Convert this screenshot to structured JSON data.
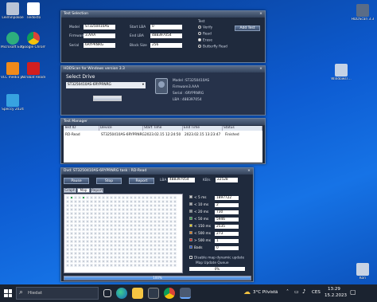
{
  "desktop": {
    "icons_left": [
      {
        "label": "Leiminpokoe",
        "icon": "recycle-bin-full-icon"
      },
      {
        "label": "Tiedosto",
        "icon": "file-icon"
      },
      {
        "label": "Microsoft Edge",
        "icon": "edge-icon"
      },
      {
        "label": "Google Chrome",
        "icon": "chrome-icon"
      },
      {
        "label": "VLC media player",
        "icon": "vlc-icon"
      },
      {
        "label": "Acrobat Reader DC",
        "icon": "acrobat-icon"
      },
      {
        "label": "Speccy 2024",
        "icon": "speccy-icon"
      }
    ],
    "icons_right": [
      {
        "label": "HDDScan 3.3",
        "icon": "hddscan-icon"
      },
      {
        "label": "WindowsT...",
        "icon": "folder-icon"
      },
      {
        "label": "Kori",
        "icon": "recycle-bin-icon"
      }
    ]
  },
  "test_selection": {
    "title": "Test Selection",
    "model_label": "Model",
    "model_value": "ST3250410AS",
    "firmware_label": "Firmware",
    "firmware_value": "3.AAA",
    "serial_label": "Serial",
    "serial_value": "6RYPRNRG",
    "start_lba_label": "Start LBA",
    "start_lba_value": "0",
    "end_lba_label": "End LBA",
    "end_lba_value": "488397054",
    "block_size_label": "Block Size",
    "block_size_value": "256",
    "test_label": "Test",
    "radios": [
      {
        "label": "Verify",
        "on": false
      },
      {
        "label": "Read",
        "on": false
      },
      {
        "label": "Erase",
        "on": true
      },
      {
        "label": "Butterfly Read",
        "on": false
      }
    ],
    "add_test": "Add Test"
  },
  "hddscan": {
    "title": "HDDScan for Windows version 3.3",
    "select_drive": "Select Drive",
    "drive_value": "ST3250410AS-6RYPRNRG",
    "model_label": "Model :",
    "model_value": "ST3250410AS",
    "firmware_label": "Firmware :",
    "firmware_value": "3.AAA",
    "serial_label": "Serial :",
    "serial_value": "6RYPRNRG",
    "lba_label": "LBA :",
    "lba_value": "488397054"
  },
  "test_manager": {
    "title": "Test Manager",
    "columns": [
      "Test ID",
      "Device",
      "Start Time",
      "End Time",
      "Status"
    ],
    "rows": [
      [
        "RD-Read",
        "ST3250410AS-6RYPRNRG",
        "2023.02.15 12:24:50",
        "2023.02.15 13:23:47",
        "Finished"
      ]
    ]
  },
  "test_window": {
    "title": "Dvd: ST3250410AS-6RYPRNRG  task : RD-Read",
    "pause": "Pause",
    "stop": "Stop",
    "report": "Report",
    "lba_label": "LBA",
    "lba_value": "488397054",
    "kbs_label": "KB/s",
    "kbs_value": "22528",
    "tabs": [
      "Graph",
      "Map",
      "Report"
    ],
    "legend": [
      {
        "label": "< 5 ms",
        "count": "1897722",
        "color": "#c9cfd8"
      },
      {
        "label": "< 10 ms",
        "count": "2",
        "color": "#a8b0bc"
      },
      {
        "label": "< 20 ms",
        "count": "730",
        "color": "#8a95a6"
      },
      {
        "label": "< 50 ms",
        "count": "5946",
        "color": "#2fa84f"
      },
      {
        "label": "< 150 ms",
        "count": "2535",
        "color": "#e6d21a"
      },
      {
        "label": "< 500 ms",
        "count": "273",
        "color": "#e07a16"
      },
      {
        "label": "> 500 ms",
        "count": "1",
        "color": "#d01818"
      },
      {
        "label": "Bads",
        "count": "0",
        "color": "#1d4fd6"
      }
    ],
    "disable_map": "Disable map dynamic update",
    "map_queue": "Map Update Queue",
    "queue_pct": "0%",
    "progress_label": "100%",
    "progress": 1.0
  },
  "taskbar": {
    "search_placeholder": "Hiedat",
    "weather": "3°C  Pilvistä",
    "lang": "CES",
    "time": "13:29",
    "date": "15.2.2023"
  }
}
